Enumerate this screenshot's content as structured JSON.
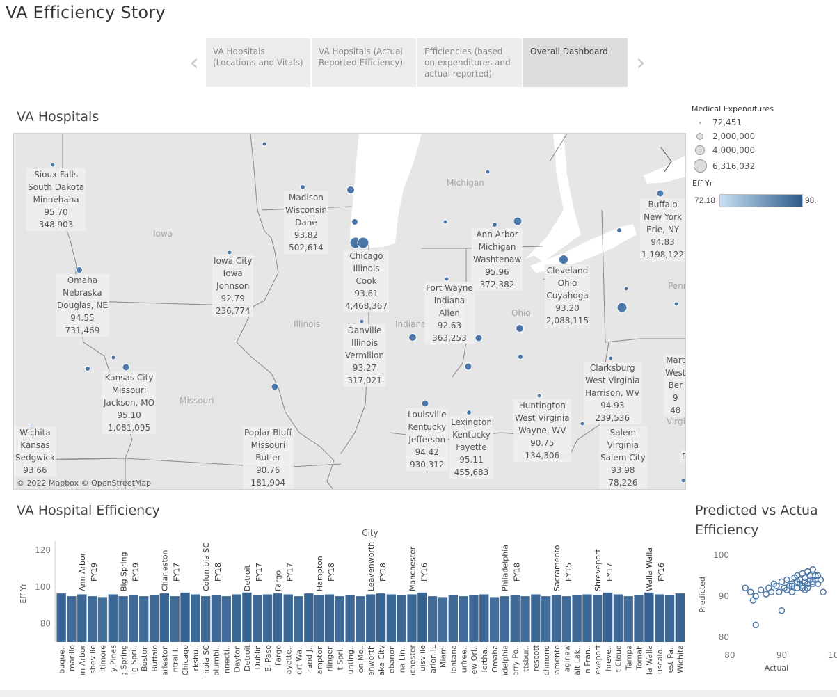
{
  "story": {
    "title": "VA Efficiency Story",
    "nav": {
      "prev_icon": "chevron-left-icon",
      "next_icon": "chevron-right-icon",
      "points": [
        {
          "label": "VA Hopsitals (Locations and Vitals)",
          "active": false
        },
        {
          "label": "VA Hopsitals (Actual Reported Efficiency)",
          "active": false
        },
        {
          "label": "Efficiencies (based on expenditures and actual reported)",
          "active": false
        },
        {
          "label": "Overall Dashboard",
          "active": true
        }
      ]
    }
  },
  "map": {
    "title": "VA Hospitals",
    "credit": "© 2022 Mapbox  © OpenStreetMap",
    "regions": [
      "Michigan",
      "Iowa",
      "Illinois",
      "Indiana",
      "Ohio",
      "Missouri",
      "Penn",
      "Virgi"
    ],
    "marker_color": "#4a76a8",
    "tooltips": [
      [
        "Sioux Falls",
        "South Dakota",
        "Minnehaha",
        "95.70",
        "348,903"
      ],
      [
        "Madison",
        "Wisconsin",
        "Dane",
        "93.82",
        "502,614"
      ],
      [
        "Iowa City",
        "Iowa",
        "Johnson",
        "92.79",
        "236,774"
      ],
      [
        "Omaha",
        "Nebraska",
        "Douglas, NE",
        "94.55",
        "731,469"
      ],
      [
        "Chicago",
        "Illinois",
        "Cook",
        "93.61",
        "4,468,367"
      ],
      [
        "Ann Arbor",
        "Michigan",
        "Washtenaw",
        "95.96",
        "372,382"
      ],
      [
        "Buffalo",
        "New York",
        "Erie, NY",
        "94.83",
        "1,198,122"
      ],
      [
        "Cleveland",
        "Ohio",
        "Cuyahoga",
        "93.20",
        "2,088,115"
      ],
      [
        "Fort Wayne",
        "Indiana",
        "Allen",
        "92.63",
        "363,253"
      ],
      [
        "Danville",
        "Illinois",
        "Vermilion",
        "93.27",
        "317,021"
      ],
      [
        "Kansas City",
        "Missouri",
        "Jackson, MO",
        "95.10",
        "1,081,095"
      ],
      [
        "Clarksburg",
        "West Virginia",
        "Harrison, WV",
        "94.93",
        "239,536"
      ],
      [
        "Mart",
        "West",
        "Ber",
        "9",
        "48"
      ],
      [
        "Huntington",
        "West Virginia",
        "Wayne, WV",
        "90.75",
        "134,306"
      ],
      [
        "Louisville",
        "Kentucky",
        "Jefferson",
        "94.42",
        "930,312"
      ],
      [
        "Lexington",
        "Kentucky",
        "Fayette",
        "95.11",
        "455,683"
      ],
      [
        "Poplar Bluff",
        "Missouri",
        "Butler",
        "90.76",
        "181,904"
      ],
      [
        "Salem",
        "Virginia",
        "Salem City",
        "93.98",
        "78,226"
      ],
      [
        "Wichita",
        "Kansas",
        "Sedgwick",
        "93.66"
      ],
      [
        "R"
      ]
    ]
  },
  "legend": {
    "size_title": "Medical Expenditures",
    "size_items": [
      "72,451",
      "2,000,000",
      "4,000,000",
      "6,316,032"
    ],
    "color_title": "Eff Yr",
    "color_min": "72.18",
    "color_max": "98.",
    "color_low": "#c8e1f5",
    "color_high": "#2c5a8b"
  },
  "bar_section": {
    "title": "VA Hospital Efficiency"
  },
  "scatter_section": {
    "title_line1": "Predicted vs Actua",
    "title_line2": "Efficiency"
  },
  "chart_data": [
    {
      "type": "bar",
      "title": "",
      "xlabel": "City",
      "ylabel": "Eff Yr",
      "ylim": [
        70,
        125
      ],
      "yticks": [
        80,
        100,
        120
      ],
      "grid": false,
      "legend": "none",
      "categories": [
        "buque..",
        "marillo",
        "Ann Arbor",
        "sheville",
        "ltimore",
        "y Pines",
        "Big Spring",
        "ig Spri..",
        "Boston",
        "Buffalo",
        "Charleston",
        "ntral I..",
        "Chicago",
        "rksbu..",
        "Columbia SC",
        "olumbi..",
        "nnecti..",
        "Dayton",
        "Detroit",
        "Dublin",
        "El Paso",
        "Fargo",
        "ayette..",
        "ort Wa..",
        "rand J..",
        "Hampton",
        "rlingen",
        "t Spri..",
        "unting..",
        "on Mo..",
        "Leavenworth",
        "ake City",
        "ebanon",
        "na Lin..",
        "Manchester",
        "uisville",
        "arion IL",
        "Miami",
        "lontana",
        "urfree..",
        "ew Orl..",
        "lortha..",
        "Omaha",
        "Philadelphia",
        "erry Po..",
        "ttsbur..",
        "rescott",
        "Richmond",
        "Sacramento",
        "aginaw",
        "alt Lak..",
        "n Fran..",
        "Shreveport",
        "hreve..",
        "t Cloud",
        "Tampa",
        "Tomah",
        "Walla Walla",
        "uscalo..",
        "est Pa..",
        "Wichita"
      ],
      "values": [
        96.5,
        95,
        96,
        95,
        94.5,
        96,
        95,
        95.5,
        95,
        95.5,
        96.5,
        95,
        97,
        96,
        95,
        95.5,
        95,
        96,
        97,
        95.5,
        96,
        96.5,
        96,
        95,
        96.5,
        95.5,
        96,
        95,
        95.5,
        95,
        96,
        96.5,
        96,
        95.5,
        96,
        97,
        95,
        94.5,
        95.5,
        95,
        95.5,
        96,
        94.5,
        95,
        95.5,
        95,
        96,
        95,
        95.5,
        95,
        95.5,
        96,
        95.5,
        97,
        96,
        95,
        95.5,
        97,
        96,
        95.5,
        96.5
      ],
      "annotations": [
        {
          "label": "Ann Arbor",
          "fy": "FY19"
        },
        {
          "label": "Big Spring",
          "fy": "FY19"
        },
        {
          "label": "Charleston",
          "fy": "FY17"
        },
        {
          "label": "Columbia SC",
          "fy": "FY18"
        },
        {
          "label": "Detroit",
          "fy": "FY17"
        },
        {
          "label": "Fargo",
          "fy": "FY17"
        },
        {
          "label": "Hampton",
          "fy": "FY18"
        },
        {
          "label": "Leavenworth",
          "fy": "FY18"
        },
        {
          "label": "Manchester",
          "fy": "FY16"
        },
        {
          "label": "Philadelphia",
          "fy": "FY18"
        },
        {
          "label": "Sacramento",
          "fy": "FY15"
        },
        {
          "label": "Shreveport",
          "fy": "FY17"
        },
        {
          "label": "Walla Walla",
          "fy": "FY16"
        }
      ]
    },
    {
      "type": "scatter",
      "title": "Predicted vs Actual Efficiency",
      "xlabel": "Actual",
      "ylabel": "Predicted",
      "xlim": [
        78,
        100
      ],
      "ylim": [
        78,
        101
      ],
      "xticks": [
        80,
        90,
        "10"
      ],
      "yticks": [
        80,
        90,
        100
      ],
      "grid": false,
      "x": [
        83,
        84,
        85,
        84.5,
        86,
        87,
        87.5,
        88,
        88.5,
        89,
        89.5,
        90,
        90.5,
        91,
        91,
        91.5,
        92,
        92,
        92.5,
        93,
        93,
        93.5,
        93.5,
        94,
        94,
        94.5,
        94.5,
        95,
        95,
        95.5,
        95.5,
        96,
        96,
        96.5,
        96.5,
        97,
        97.5,
        98,
        90,
        85,
        94,
        93,
        95,
        92,
        96,
        97,
        94.5,
        93.5
      ],
      "y": [
        92,
        91,
        90,
        89,
        91.5,
        90.5,
        92,
        91,
        93,
        92.5,
        91,
        93.5,
        92,
        91.5,
        94,
        92.5,
        93,
        91,
        94.5,
        92,
        95,
        93,
        94,
        92.5,
        95.5,
        93.5,
        94.5,
        93,
        96,
        94,
        95,
        93.5,
        96.5,
        94,
        95,
        93,
        94,
        91,
        86.5,
        83,
        92,
        93.5,
        92,
        92.5,
        93,
        95,
        91.5,
        94
      ]
    }
  ]
}
